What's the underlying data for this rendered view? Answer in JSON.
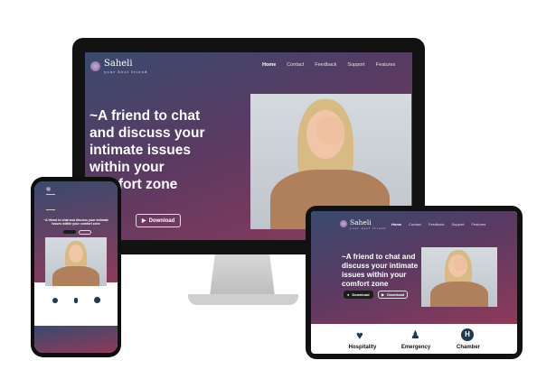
{
  "site": {
    "brand": "Saheli",
    "tagline": "your best friend",
    "nav": [
      "Home",
      "Contact",
      "Feedback",
      "Support",
      "Features"
    ],
    "active_nav": "Home"
  },
  "hero": {
    "desktop_title_lines": [
      "~A friend to chat",
      "and discuss your",
      "intimate issues",
      "within your",
      "comfort zone"
    ],
    "tablet_title_lines": [
      "~A friend to chat and",
      "discuss your intimate",
      "issues within your",
      "comfort zone"
    ],
    "download_dark": "Download",
    "download_outline": "Download"
  },
  "features": [
    "Hospitality",
    "Emergency",
    "Chamber"
  ],
  "colors": {
    "accent": "#8e3a5a",
    "gradient_start": "#3a4a6e",
    "gradient_end": "#8e3a5a"
  }
}
